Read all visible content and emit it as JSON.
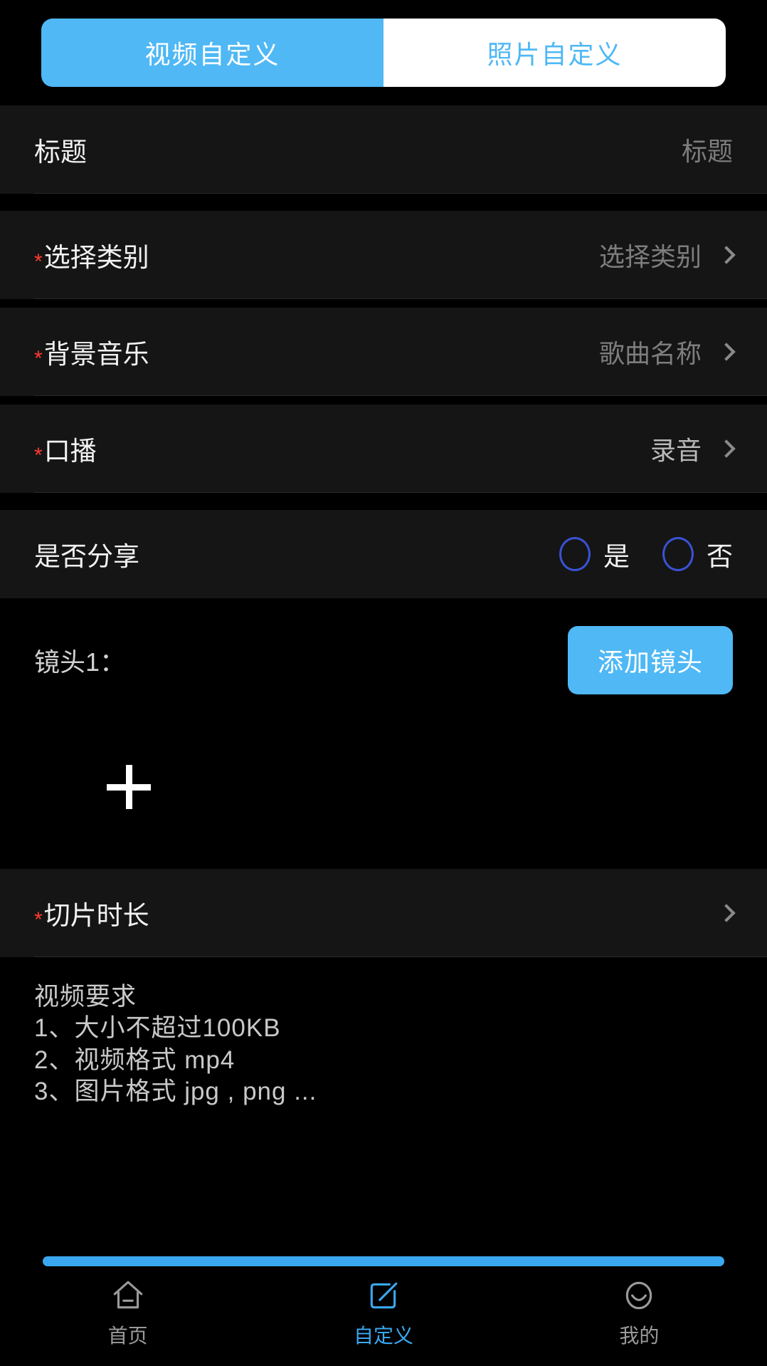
{
  "tabs": {
    "video_custom": "视频自定义",
    "photo_custom": "照片自定义"
  },
  "form": {
    "title_row": {
      "label": "标题",
      "placeholder": "标题"
    },
    "category_row": {
      "star": "*",
      "label": "选择类别",
      "placeholder": "选择类别",
      "chevron": "chevron-right-icon"
    },
    "bgm_row": {
      "star": "*",
      "label": "背景音乐",
      "placeholder": "歌曲名称",
      "chevron": "chevron-right-icon"
    },
    "voiceover_row": {
      "star": "*",
      "label": "口播",
      "value": "录音",
      "chevron": "chevron-right-icon"
    },
    "share_row": {
      "label": "是否分享",
      "options": [
        {
          "label": "是",
          "selected": false
        },
        {
          "label": "否",
          "selected": false
        }
      ]
    },
    "clip_duration_row": {
      "star": "*",
      "label": "切片时长",
      "chevron": "chevron-right-icon"
    }
  },
  "shot": {
    "label": "镜头1：",
    "add_button": "添加镜头",
    "add_media_icon": "plus-icon"
  },
  "requirements": {
    "heading": "视频要求",
    "lines": [
      "1、大小不超过100KB",
      "2、视频格式 mp4",
      "3、图片格式 jpg , png ..."
    ]
  },
  "bottom_nav": {
    "items": [
      {
        "label": "首页",
        "icon": "home-icon",
        "active": false
      },
      {
        "label": "自定义",
        "icon": "edit-square-icon",
        "active": true
      },
      {
        "label": "我的",
        "icon": "smiley-face-icon",
        "active": false
      }
    ]
  },
  "colors": {
    "accent_blue": "#4fb8f5",
    "nav_active_blue": "#3aa8f0",
    "required_red": "#ff3b30",
    "radio_blue": "#3a52d6",
    "row_bg": "#151515",
    "page_bg": "#000000"
  }
}
